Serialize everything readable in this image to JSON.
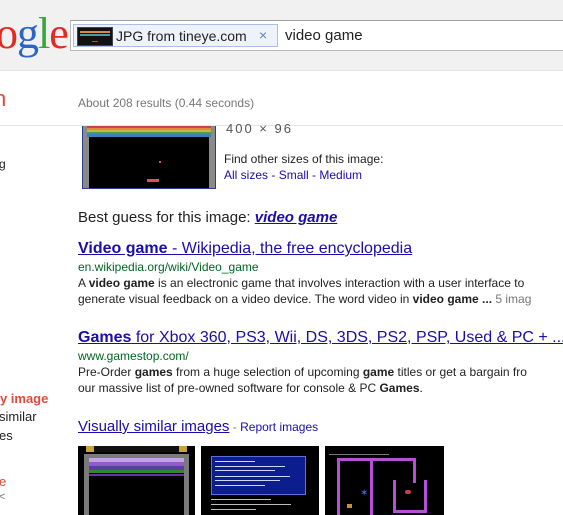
{
  "header": {
    "logo_letters": [
      {
        "char": "o",
        "color": "#e42a20"
      },
      {
        "char": "g",
        "color": "#2d64c8"
      },
      {
        "char": "l",
        "color": "#3aa53a"
      },
      {
        "char": "e",
        "color": "#e42a20"
      }
    ],
    "search_chip_label": "JPG from tineye.com",
    "search_chip_remove": "×",
    "search_query": "video game"
  },
  "left_column": {
    "orange_mark": "n",
    "line_g": "g",
    "copy_label": "py image",
    "similar_label": "similar",
    "es_label": "es",
    "e_label": "e",
    "k_label": "<"
  },
  "stats": "About 208 results (0.44 seconds)",
  "image_info": {
    "partial_size": "400 × 96",
    "other_sizes_label": "Find other sizes of this image:",
    "all_sizes": "All sizes",
    "small": "Small",
    "medium": "Medium",
    "sep": " - "
  },
  "best_guess": {
    "label": "Best guess for this image:",
    "link": "video game"
  },
  "results": [
    {
      "title_bold": "Video game",
      "title_rest": " - Wikipedia, the free encyclopedia",
      "url": "en.wikipedia.org/wiki/Video_game",
      "snippet_line1_a": "A ",
      "snippet_line1_b": "video game",
      "snippet_line1_c": " is an electronic game that involves interaction with a user interface to",
      "snippet_line2_a": "generate visual feedback on a video device. The word video in ",
      "snippet_line2_b": "video game ...",
      "snippet_line2_c": " 5 imag"
    },
    {
      "title_bold": "Games",
      "title_rest": " for Xbox 360, PS3, Wii, DS, 3DS, PS2, PSP, Used & PC + ...",
      "url": "www.gamestop.com/",
      "snippet_line1_a": "Pre-Order ",
      "snippet_line1_b": "games",
      "snippet_line1_c": " from a huge selection of upcoming ",
      "snippet_line1_d": "game",
      "snippet_line1_e": " titles or get a bargain fro",
      "snippet_line2_a": "our massive list of pre-owned software for console & PC ",
      "snippet_line2_b": "Games",
      "snippet_line2_c": "."
    }
  ],
  "similar": {
    "link": "Visually similar images",
    "sep": " - ",
    "report": "Report images"
  }
}
